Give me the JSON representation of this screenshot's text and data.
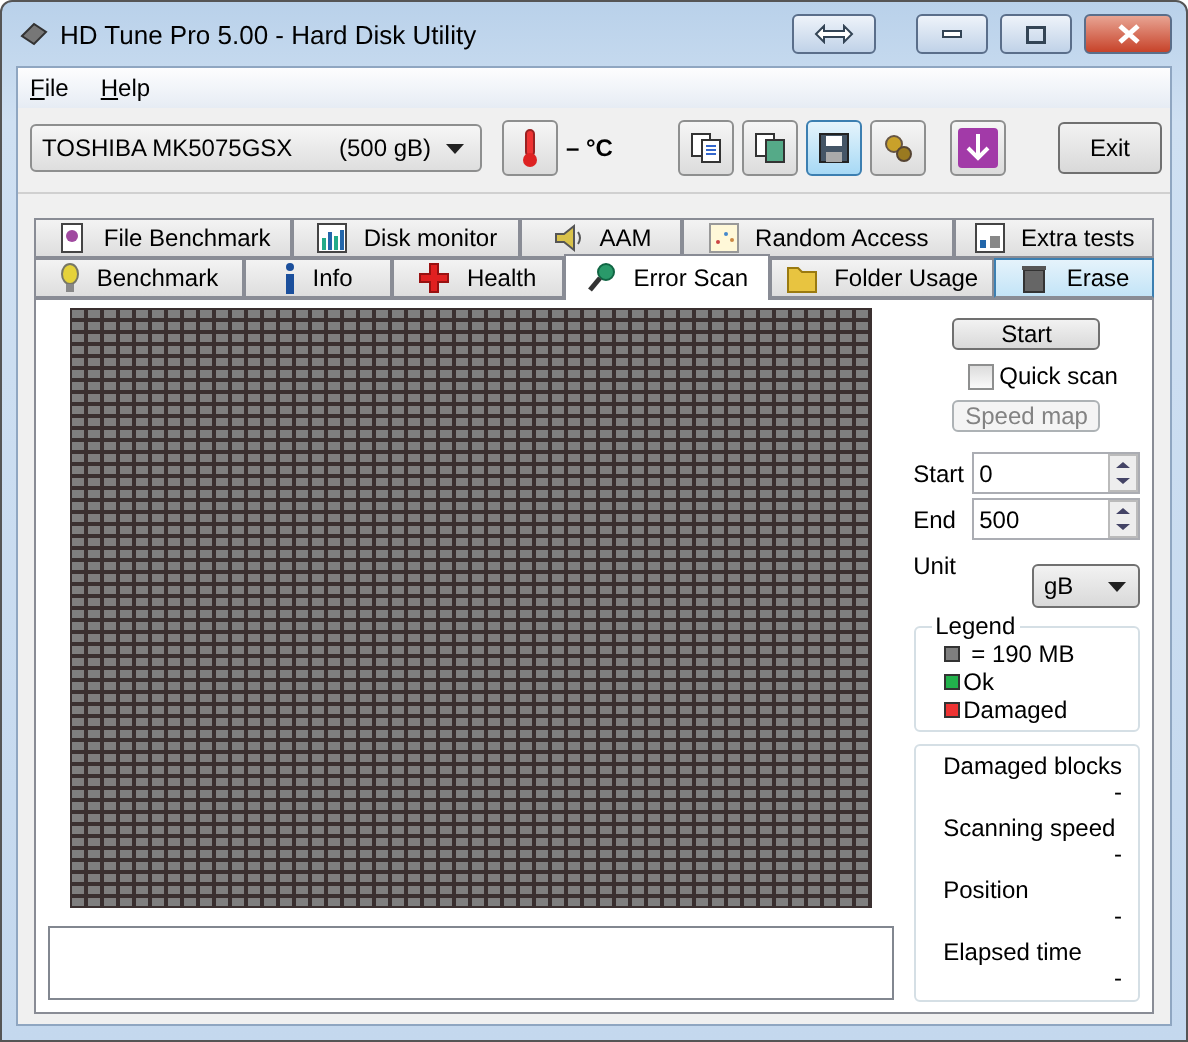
{
  "window": {
    "title": "HD Tune Pro 5.00 - Hard Disk Utility"
  },
  "menu": [
    {
      "label": "File"
    },
    {
      "label": "Help"
    }
  ],
  "toolbar": {
    "drive": "TOSHIBA MK5075GSX       (500 gB)",
    "temperature": "– °C",
    "exit": "Exit"
  },
  "tab_rows": [
    [
      {
        "label": "File Benchmark",
        "selected": false,
        "highlighted": false
      },
      {
        "label": "Disk monitor",
        "selected": false,
        "highlighted": false
      },
      {
        "label": "AAM",
        "selected": false,
        "highlighted": false
      },
      {
        "label": "Random Access",
        "selected": false,
        "highlighted": false
      },
      {
        "label": "Extra tests",
        "selected": false,
        "highlighted": false
      }
    ],
    [
      {
        "label": "Benchmark",
        "selected": false,
        "highlighted": false
      },
      {
        "label": "Info",
        "selected": false,
        "highlighted": false
      },
      {
        "label": "Health",
        "selected": false,
        "highlighted": false
      },
      {
        "label": "Error Scan",
        "selected": true,
        "highlighted": false
      },
      {
        "label": "Folder Usage",
        "selected": false,
        "highlighted": false
      },
      {
        "label": "Erase",
        "selected": false,
        "highlighted": true
      }
    ]
  ],
  "controls": {
    "start_button": "Start",
    "quick_scan": {
      "label": "Quick scan",
      "checked": false
    },
    "speed_map": {
      "label": "Speed map",
      "disabled": true
    },
    "fields": [
      {
        "label": "Start",
        "value": "0"
      },
      {
        "label": "End",
        "value": "500"
      }
    ],
    "unit": {
      "label": "Unit",
      "value": "gB"
    }
  },
  "legend": {
    "title": "Legend",
    "items": [
      {
        "label": "= 190 MB",
        "color": "#7f7f7f"
      },
      {
        "label": "Ok",
        "color": "#22b24c"
      },
      {
        "label": "Damaged",
        "color": "#ee3333"
      }
    ]
  },
  "stats": [
    {
      "label": "Damaged blocks",
      "value": "-"
    },
    {
      "label": "Scanning speed",
      "value": "-"
    },
    {
      "label": "Position",
      "value": "-"
    },
    {
      "label": "Elapsed time",
      "value": "-"
    }
  ]
}
